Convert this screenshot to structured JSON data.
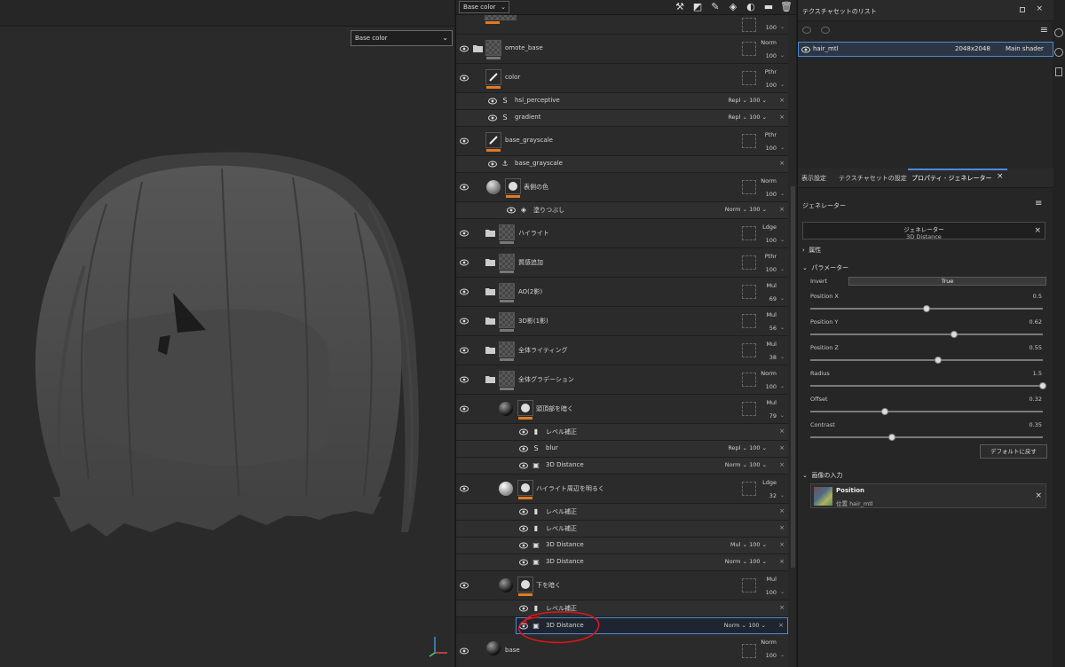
{
  "viewport": {
    "channel_select": "Base color"
  },
  "layers": {
    "toolbar": {
      "channel_select": "Base color",
      "icons": [
        "magic-wand-icon",
        "mask-icon",
        "brush-icon",
        "fill-icon",
        "effects-icon",
        "folder-icon",
        "trash-icon"
      ]
    },
    "rows": [
      {
        "name": "",
        "blend": "",
        "opacity": "100"
      },
      {
        "name": "omote_base",
        "blend": "Norm",
        "opacity": "100"
      },
      {
        "name": "color",
        "blend": "Pthr",
        "opacity": "100"
      },
      {
        "name": "hsl_perceptive",
        "blend": "Repl",
        "opacity": "100"
      },
      {
        "name": "gradient",
        "blend": "Repl",
        "opacity": "100"
      },
      {
        "name": "base_grayscale",
        "blend": "Pthr",
        "opacity": "100"
      },
      {
        "name": "base_grayscale"
      },
      {
        "name": "表側の色",
        "blend": "Norm",
        "opacity": "100"
      },
      {
        "name": "塗りつぶし",
        "blend": "Norm",
        "opacity": "100"
      },
      {
        "name": "ハイライト",
        "blend": "Ldge",
        "opacity": "100"
      },
      {
        "name": "質感追加",
        "blend": "Pthr",
        "opacity": "100"
      },
      {
        "name": "AO(2影)",
        "blend": "Mul",
        "opacity": "69"
      },
      {
        "name": "3D影(1影)",
        "blend": "Mul",
        "opacity": "56"
      },
      {
        "name": "全体ライティング",
        "blend": "Mul",
        "opacity": "38"
      },
      {
        "name": "全体グラデーション",
        "blend": "Norm",
        "opacity": "100"
      },
      {
        "name": "頭頂部を暗く",
        "blend": "Mul",
        "opacity": "79"
      },
      {
        "name": "レベル補正"
      },
      {
        "name": "blur",
        "blend": "Repl",
        "opacity": "100"
      },
      {
        "name": "3D Distance",
        "blend": "Norm",
        "opacity": "100"
      },
      {
        "name": "ハイライト周辺を明るく",
        "blend": "Ldge",
        "opacity": "32"
      },
      {
        "name": "レベル補正"
      },
      {
        "name": "レベル補正"
      },
      {
        "name": "3D Distance",
        "blend": "Mul",
        "opacity": "100"
      },
      {
        "name": "3D Distance",
        "blend": "Norm",
        "opacity": "100"
      },
      {
        "name": "下を暗く",
        "blend": "Mul",
        "opacity": "100"
      },
      {
        "name": "レベル補正"
      },
      {
        "name": "3D Distance",
        "blend": "Norm",
        "opacity": "100"
      },
      {
        "name": "base",
        "blend": "Norm",
        "opacity": "100"
      }
    ]
  },
  "texture_set_list": {
    "title": "テクスチャセットのリスト",
    "item": {
      "name": "hair_mtl",
      "resolution": "2048x2048",
      "shader": "Main shader"
    }
  },
  "tabs": [
    "表示設定",
    "テクスチャセットの設定",
    "プロパティ - ジェネレーター"
  ],
  "properties": {
    "section_title": "ジェネレーター",
    "generator_title": "ジェネレーター",
    "generator_name": "3D Distance",
    "attributes_label": "属性",
    "parameters_label": "パラメーター",
    "invert_label": "Invert",
    "invert_value": "True",
    "params": [
      {
        "label": "Position X",
        "value": "0.5",
        "fraction": 0.5
      },
      {
        "label": "Position Y",
        "value": "0.62",
        "fraction": 0.62
      },
      {
        "label": "Position Z",
        "value": "0.55",
        "fraction": 0.55
      },
      {
        "label": "Radius",
        "value": "1.5",
        "fraction": 1.0
      },
      {
        "label": "Offset",
        "value": "0.32",
        "fraction": 0.32
      },
      {
        "label": "Contrast",
        "value": "0.35",
        "fraction": 0.35
      }
    ],
    "reset_button": "デフォルトに戻す",
    "image_input_label": "画像の入力",
    "input_name": "Position",
    "input_sub": "位置 hair_mtl"
  },
  "colors": {
    "accent": "#e07a22",
    "selection": "#4a8bd6",
    "annotation": "#e0161b"
  }
}
